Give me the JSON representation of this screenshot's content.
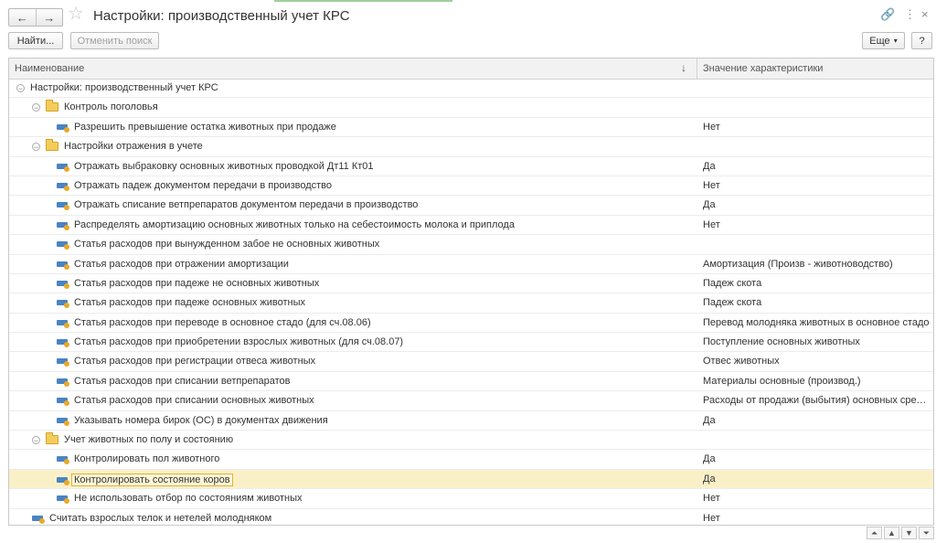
{
  "window": {
    "title": "Настройки: производственный учет КРС",
    "back_glyph": "←",
    "forward_glyph": "→",
    "favorite_glyph": "☆",
    "link_glyph": "🔗",
    "more_glyph": "⋮",
    "close_glyph": "×"
  },
  "toolbar": {
    "find_label": "Найти...",
    "cancel_search_label": "Отменить поиск",
    "more_label": "Еще",
    "more_arrow": "▾",
    "help_label": "?"
  },
  "grid": {
    "columns": [
      "Наименование",
      "Значение характеристики"
    ],
    "sort_glyph": "↓",
    "rows": [
      {
        "level": 0,
        "kind": "group",
        "name": "Настройки: производственный учет КРС",
        "value": ""
      },
      {
        "level": 1,
        "kind": "folder",
        "name": "Контроль поголовья",
        "value": ""
      },
      {
        "level": 2,
        "kind": "param",
        "name": "Разрешить превышение остатка животных при продаже",
        "value": "Нет"
      },
      {
        "level": 1,
        "kind": "folder",
        "name": "Настройки отражения в учете",
        "value": ""
      },
      {
        "level": 2,
        "kind": "param",
        "name": "Отражать выбраковку основных животных проводкой Дт11 Кт01",
        "value": "Да"
      },
      {
        "level": 2,
        "kind": "param",
        "name": "Отражать падеж документом передачи в производство",
        "value": "Нет"
      },
      {
        "level": 2,
        "kind": "param",
        "name": "Отражать списание ветпрепаратов документом передачи в производство",
        "value": "Да"
      },
      {
        "level": 2,
        "kind": "param",
        "name": "Распределять амортизацию основных животных только на себестоимость молока и приплода",
        "value": "Нет"
      },
      {
        "level": 2,
        "kind": "param",
        "name": "Статья расходов при вынужденном забое не основных животных",
        "value": ""
      },
      {
        "level": 2,
        "kind": "param",
        "name": "Статья расходов при отражении амортизации",
        "value": "Амортизация (Произв - животноводство)"
      },
      {
        "level": 2,
        "kind": "param",
        "name": "Статья расходов при падеже не основных животных",
        "value": "Падеж скота"
      },
      {
        "level": 2,
        "kind": "param",
        "name": "Статья расходов при падеже основных животных",
        "value": "Падеж скота"
      },
      {
        "level": 2,
        "kind": "param",
        "name": "Статья расходов при переводе в основное стадо (для сч.08.06)",
        "value": "Перевод молодняка животных в основное стадо"
      },
      {
        "level": 2,
        "kind": "param",
        "name": "Статья расходов при приобретении взрослых животных (для сч.08.07)",
        "value": "Поступление основных животных"
      },
      {
        "level": 2,
        "kind": "param",
        "name": "Статья расходов при регистрации отвеса животных",
        "value": "Отвес животных"
      },
      {
        "level": 2,
        "kind": "param",
        "name": "Статья расходов при списании ветпрепаратов",
        "value": "Материалы основные (производ.)"
      },
      {
        "level": 2,
        "kind": "param",
        "name": "Статья расходов при списании основных животных",
        "value": "Расходы от продажи (выбытия) основных средс..."
      },
      {
        "level": 2,
        "kind": "param",
        "name": "Указывать номера бирок (ОС) в документах движения",
        "value": "Да"
      },
      {
        "level": 1,
        "kind": "folder",
        "name": "Учет животных по полу и состоянию",
        "value": ""
      },
      {
        "level": 2,
        "kind": "param",
        "name": "Контролировать пол животного",
        "value": "Да"
      },
      {
        "level": 2,
        "kind": "param",
        "name": "Контролировать состояние коров",
        "value": "Да",
        "selected": true
      },
      {
        "level": 2,
        "kind": "param",
        "name": "Не использовать отбор по состояниям животных",
        "value": "Нет"
      },
      {
        "level": 1,
        "kind": "param",
        "name": "Считать взрослых телок и нетелей молодняком",
        "value": "Нет"
      }
    ]
  },
  "scroll": {
    "first_glyph": "⏶",
    "up_glyph": "▲",
    "down_glyph": "▼",
    "last_glyph": "⏷"
  }
}
